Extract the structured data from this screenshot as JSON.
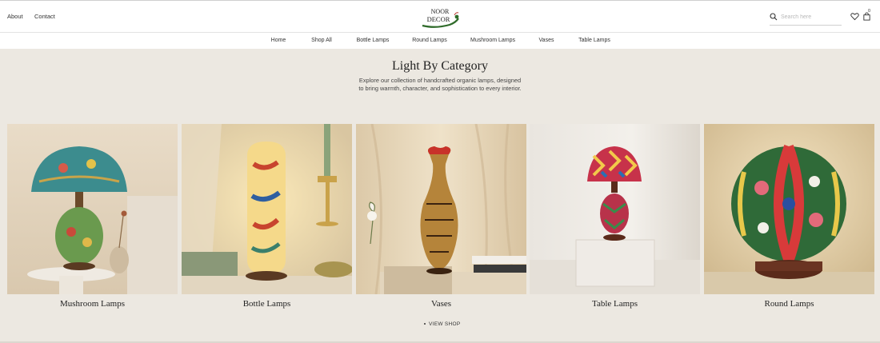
{
  "header": {
    "util_links": [
      "About",
      "Contact"
    ],
    "logo_line1": "NOOR",
    "logo_line2": "DECOR",
    "search_placeholder": "Search here",
    "cart_count": "0"
  },
  "nav": {
    "items": [
      "Home",
      "Shop All",
      "Bottle Lamps",
      "Round Lamps",
      "Mushroom Lamps",
      "Vases",
      "Table Lamps"
    ]
  },
  "section": {
    "title": "Light By Category",
    "description_line1": "Explore our collection of handcrafted organic lamps, designed",
    "description_line2": "to bring warmth, character, and sophistication to every interior."
  },
  "categories": [
    {
      "label": "Mushroom Lamps",
      "icon": "mushroom-lamp-photo"
    },
    {
      "label": "Bottle Lamps",
      "icon": "bottle-lamp-photo"
    },
    {
      "label": "Vases",
      "icon": "vase-photo"
    },
    {
      "label": "Table Lamps",
      "icon": "table-lamp-photo"
    },
    {
      "label": "Round Lamps",
      "icon": "round-lamp-photo"
    }
  ],
  "view_shop": "VIEW SHOP",
  "colors": {
    "background": "#ece8e1",
    "header": "#ffffff",
    "logo_green": "#2f6b2a"
  }
}
